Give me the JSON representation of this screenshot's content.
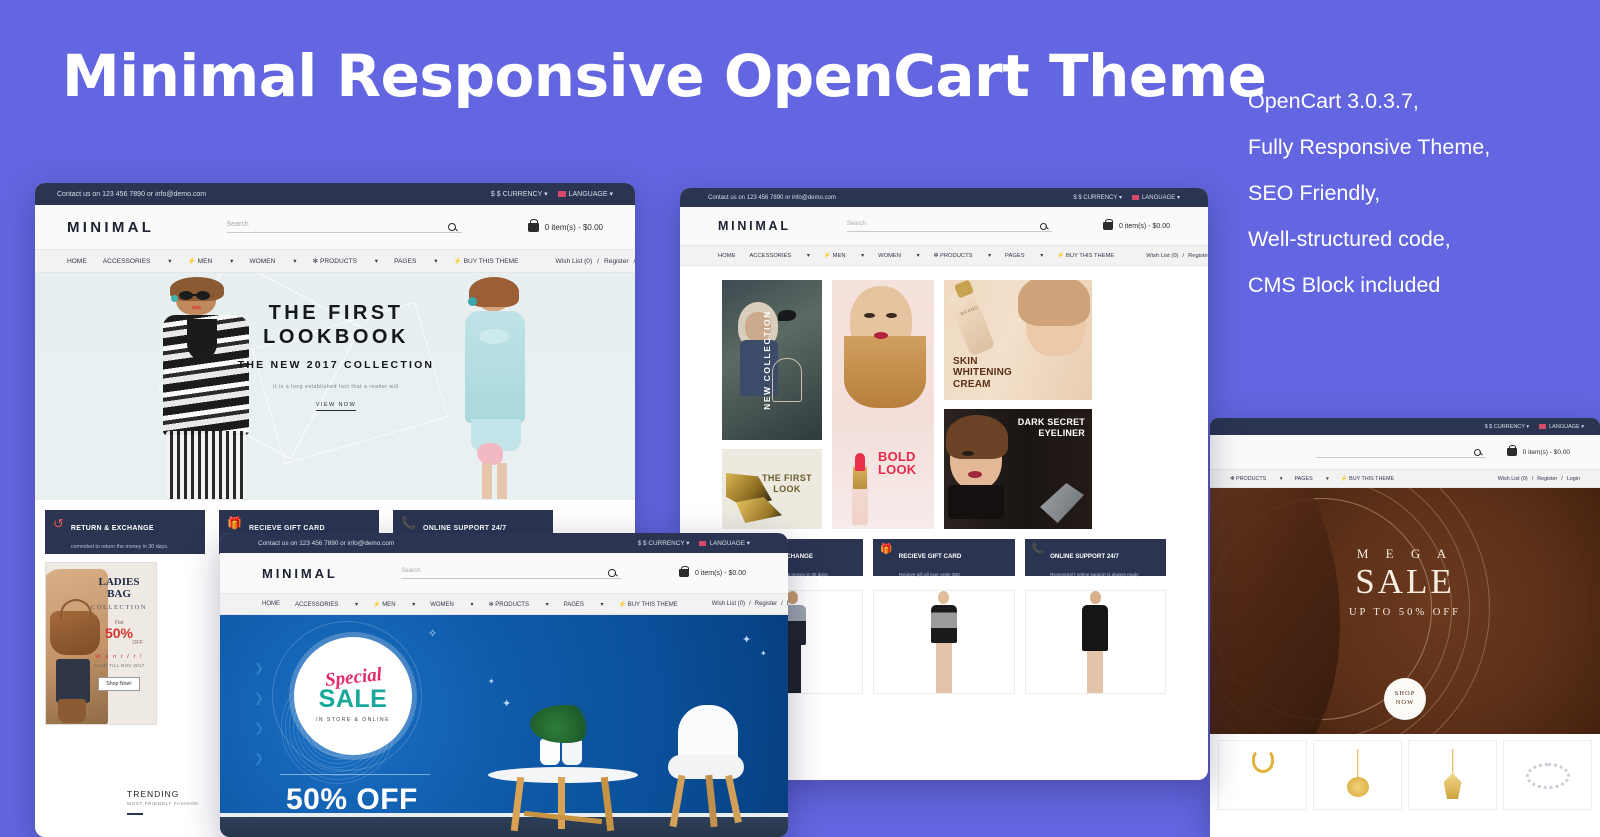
{
  "headline": "Minimal Responsive OpenCart Theme",
  "features": [
    "OpenCart 3.0.3.7,",
    "Fully Responsive Theme,",
    "SEO Friendly,",
    "Well-structured code,",
    "CMS Block included"
  ],
  "colors": {
    "background": "#6366e0",
    "topbar": "#2b3552",
    "accent_red": "#e5554f",
    "sale_blue": "#0f5aa8",
    "mega_brown": "#5c3018"
  },
  "storefront": {
    "contact": "Contact us on 123 456 7890 or info@demo.com",
    "currency": "$ CURRENCY",
    "language": "LANGUAGE",
    "brand": "MINIMAL",
    "search_placeholder": "Search",
    "cart": "0 item(s) - $0.00",
    "menu": [
      "HOME",
      "ACCESSORIES",
      "MEN",
      "WOMEN",
      "PRODUCTS",
      "PAGES",
      "BUY THIS THEME"
    ],
    "account": [
      "Wish List (0)",
      "/",
      "Register",
      "/",
      "Login"
    ],
    "icons": {
      "search": "search-icon",
      "cart": "shopping-bag-icon",
      "currency": "dollar-icon",
      "language": "flag-icon",
      "caret": "chevron-down-icon"
    }
  },
  "services": [
    {
      "title": "RETURN & EXCHANGE",
      "subtitle": "commited to return the money in 30 days.",
      "icon": "return-arrow-icon"
    },
    {
      "title": "RECIEVE GIFT CARD",
      "subtitle": "Recieve gift all over order $50",
      "icon": "gift-card-icon"
    },
    {
      "title": "ONLINE SUPPORT 24/7",
      "subtitle": "Recieve24/7 online support is always ready",
      "icon": "headset-phone-icon"
    }
  ],
  "mockup1": {
    "hero": {
      "line1": "THE FIRST",
      "line2": "LOOKBOOK",
      "line3": "THE NEW 2017 COLLECTION",
      "line4": "It is a long established fact that a reader will",
      "button": "VIEW NOW"
    },
    "bag_promo": {
      "title1": "LADIES",
      "title2": "BAG",
      "collection": "COLLECTION",
      "flat": "Flat",
      "percent": "50%",
      "off": "OFF",
      "want": "W a n t   I t !",
      "valid": "VALID TILL NOV 2017",
      "button": "Shop Now!"
    },
    "trending": {
      "title": "TRENDING",
      "subtitle": "MOST FRIENDLY FASHION"
    }
  },
  "mockup2": {
    "banners": [
      {
        "name": "new-collection",
        "text": "NEW COLLECTION"
      },
      {
        "name": "the-first-look",
        "text": "THE FIRST LOOK"
      },
      {
        "name": "bold-look",
        "text": "BOLD LOOK"
      },
      {
        "name": "skin-whitening-cream",
        "text": "SKIN WHITENING CREAM"
      },
      {
        "name": "dark-secret-eyeliner",
        "text": "DARK SECRET EYELINER"
      }
    ],
    "brand_label": "BRAND"
  },
  "mockup3": {
    "sale": {
      "script": "Special",
      "main": "SALE",
      "sub": "IN STORE & ONLINE",
      "discount": "50% OFF"
    }
  },
  "mockup4": {
    "mega": {
      "line1": "M E G A",
      "line2": "SALE",
      "line3": "UP TO 50% OFF",
      "button_line1": "SHOP",
      "button_line2": "NOW"
    }
  }
}
